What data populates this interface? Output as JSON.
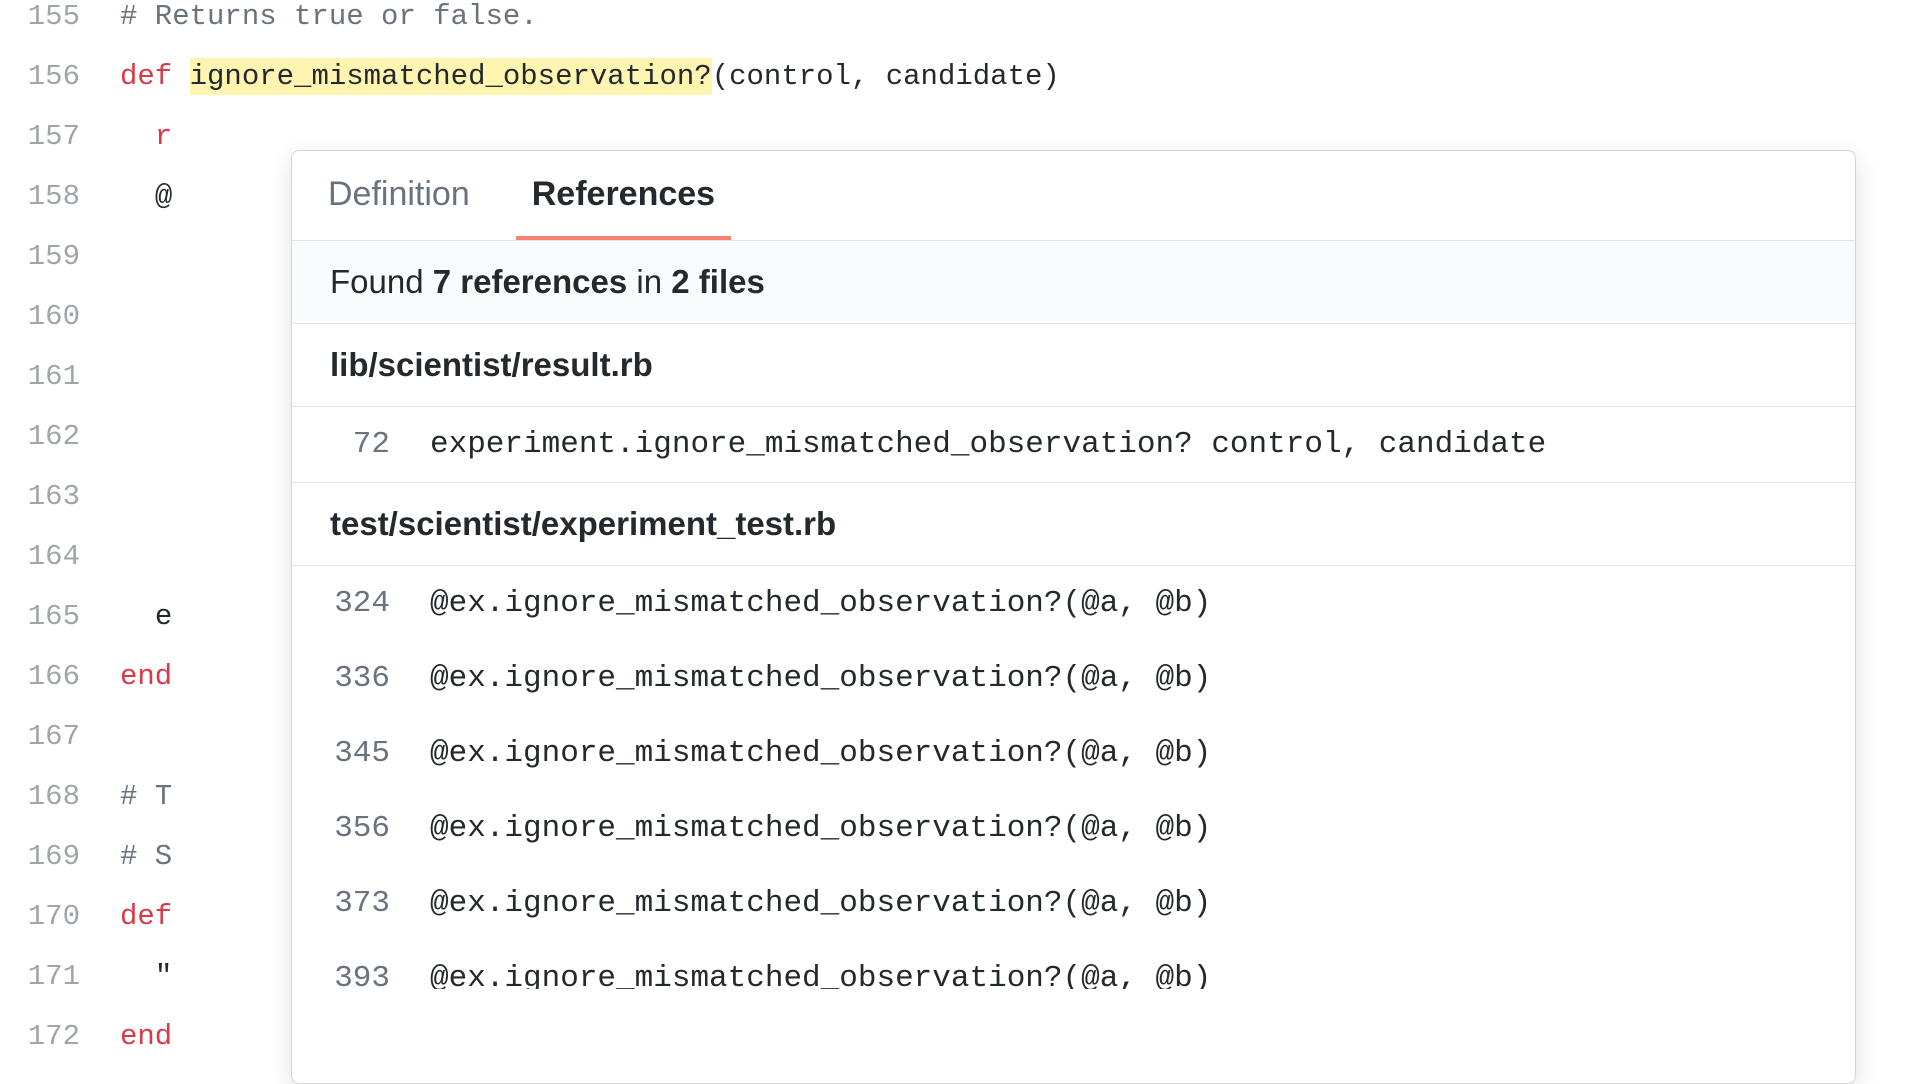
{
  "code": {
    "lines": [
      {
        "num": "155",
        "comment": "# Returns true or false."
      },
      {
        "num": "156",
        "def": "def ",
        "symbol": "ignore_mismatched_observation?",
        "rest": "(control, candidate)"
      },
      {
        "num": "157",
        "partial_red": "r"
      },
      {
        "num": "158",
        "partial_text": "@"
      },
      {
        "num": "159"
      },
      {
        "num": "160"
      },
      {
        "num": "161"
      },
      {
        "num": "162"
      },
      {
        "num": "163"
      },
      {
        "num": "164"
      },
      {
        "num": "165",
        "partial_text": "e"
      },
      {
        "num": "166",
        "keyword": "end"
      },
      {
        "num": "167"
      },
      {
        "num": "168",
        "comment_partial": "# T"
      },
      {
        "num": "169",
        "comment_partial": "# S"
      },
      {
        "num": "170",
        "keyword": "def"
      },
      {
        "num": "171",
        "partial_text": "\""
      },
      {
        "num": "172",
        "keyword": "end"
      }
    ]
  },
  "popup": {
    "tabs": {
      "definition": "Definition",
      "references": "References"
    },
    "summary": {
      "found": "Found ",
      "count": "7 references",
      "in": " in ",
      "files": "2 files"
    },
    "groups": [
      {
        "file": "lib/scientist/result.rb",
        "refs": [
          {
            "line": "72",
            "code": "experiment.ignore_mismatched_observation? control, candidate"
          }
        ]
      },
      {
        "file": "test/scientist/experiment_test.rb",
        "refs": [
          {
            "line": "324",
            "code": "@ex.ignore_mismatched_observation?(@a, @b)"
          },
          {
            "line": "336",
            "code": "@ex.ignore_mismatched_observation?(@a, @b)"
          },
          {
            "line": "345",
            "code": "@ex.ignore_mismatched_observation?(@a, @b)"
          },
          {
            "line": "356",
            "code": "@ex.ignore_mismatched_observation?(@a, @b)"
          },
          {
            "line": "373",
            "code": "@ex.ignore_mismatched_observation?(@a, @b)"
          },
          {
            "line": "393",
            "code": "@ex.ignore_mismatched_observation?(@a, @b)"
          }
        ]
      }
    ]
  }
}
